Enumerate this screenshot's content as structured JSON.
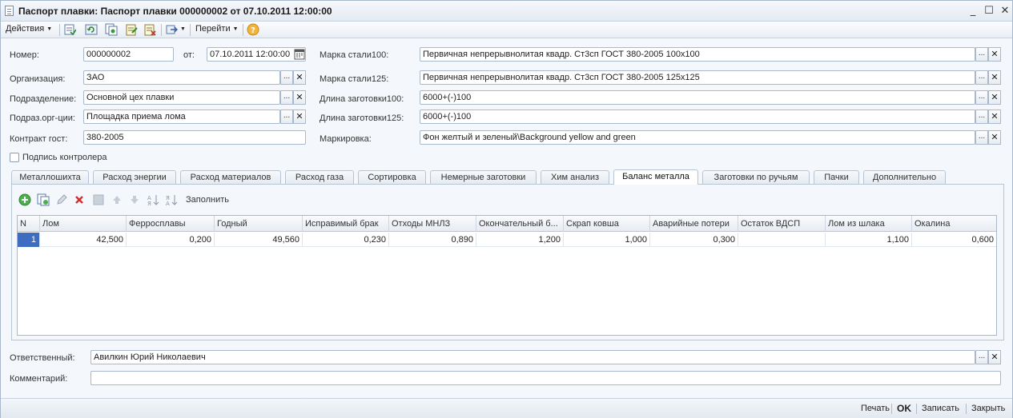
{
  "window": {
    "title": "Паспорт плавки: Паспорт плавки 000000002 от 07.10.2011 12:00:00",
    "minimize_glyph": "_",
    "maximize_glyph": "☐",
    "close_glyph": "✕"
  },
  "toolbar": {
    "actions_label": "Действия",
    "goto_label": "Перейти",
    "help_glyph": "?"
  },
  "form": {
    "number_label": "Номер:",
    "number_value": "000000002",
    "date_label": "от:",
    "date_value": "07.10.2011 12:00:00",
    "org_label": "Организация:",
    "org_value": "ЗАО",
    "dept_label": "Подразделение:",
    "dept_value": "Основной цех плавки",
    "sub_label": "Подраз.орг-ции:",
    "sub_value": "Площадка приема лома",
    "contract_label": "Контракт гост:",
    "contract_value": "380-2005",
    "steel100_label": "Марка стали100:",
    "steel100_value": "Первичная непрерывнолитая квадр. Ст3сп ГОСТ 380-2005 100х100",
    "steel125_label": "Марка стали125:",
    "steel125_value": "Первичная непрерывнолитая квадр. Ст3сп ГОСТ 380-2005 125х125",
    "len100_label": "Длина заготовки100:",
    "len100_value": "6000+(-)100",
    "len125_label": "Длина заготовки125:",
    "len125_value": "6000+(-)100",
    "marking_label": "Маркировка:",
    "marking_value": "Фон желтый и зеленый\\Background yellow and green",
    "controller_sign_label": "Подпись контролера",
    "select_glyph": "...",
    "clear_glyph": "✕"
  },
  "tabs": [
    {
      "label": "Металлошихта"
    },
    {
      "label": "Расход энергии"
    },
    {
      "label": "Расход материалов"
    },
    {
      "label": "Расход газа"
    },
    {
      "label": "Сортировка"
    },
    {
      "label": "Немерные заготовки"
    },
    {
      "label": "Хим анализ"
    },
    {
      "label": "Баланс металла"
    },
    {
      "label": "Заготовки по ручьям"
    },
    {
      "label": "Пачки"
    },
    {
      "label": "Дополнительно"
    }
  ],
  "active_tab": "Баланс металла",
  "grid_toolbar": {
    "fill_label": "Заполнить"
  },
  "table": {
    "columns": [
      "N",
      "Лом",
      "Ферросплавы",
      "Годный",
      "Исправимый брак",
      "Отходы МНЛЗ",
      "Окончательный б...",
      "Скрап ковша",
      "Аварийные потери",
      "Остаток ВДСП",
      "Лом из шлака",
      "Окалина"
    ],
    "rows": [
      [
        "1",
        "42,500",
        "0,200",
        "49,560",
        "0,230",
        "0,890",
        "1,200",
        "1,000",
        "0,300",
        "",
        "1,100",
        "0,600"
      ]
    ]
  },
  "bottom": {
    "responsible_label": "Ответственный:",
    "responsible_value": "Авилкин Юрий Николаевич",
    "comment_label": "Комментарий:",
    "comment_value": ""
  },
  "footer": {
    "print_label": "Печать",
    "ok_label": "OK",
    "save_label": "Записать",
    "close_label": "Закрыть"
  }
}
